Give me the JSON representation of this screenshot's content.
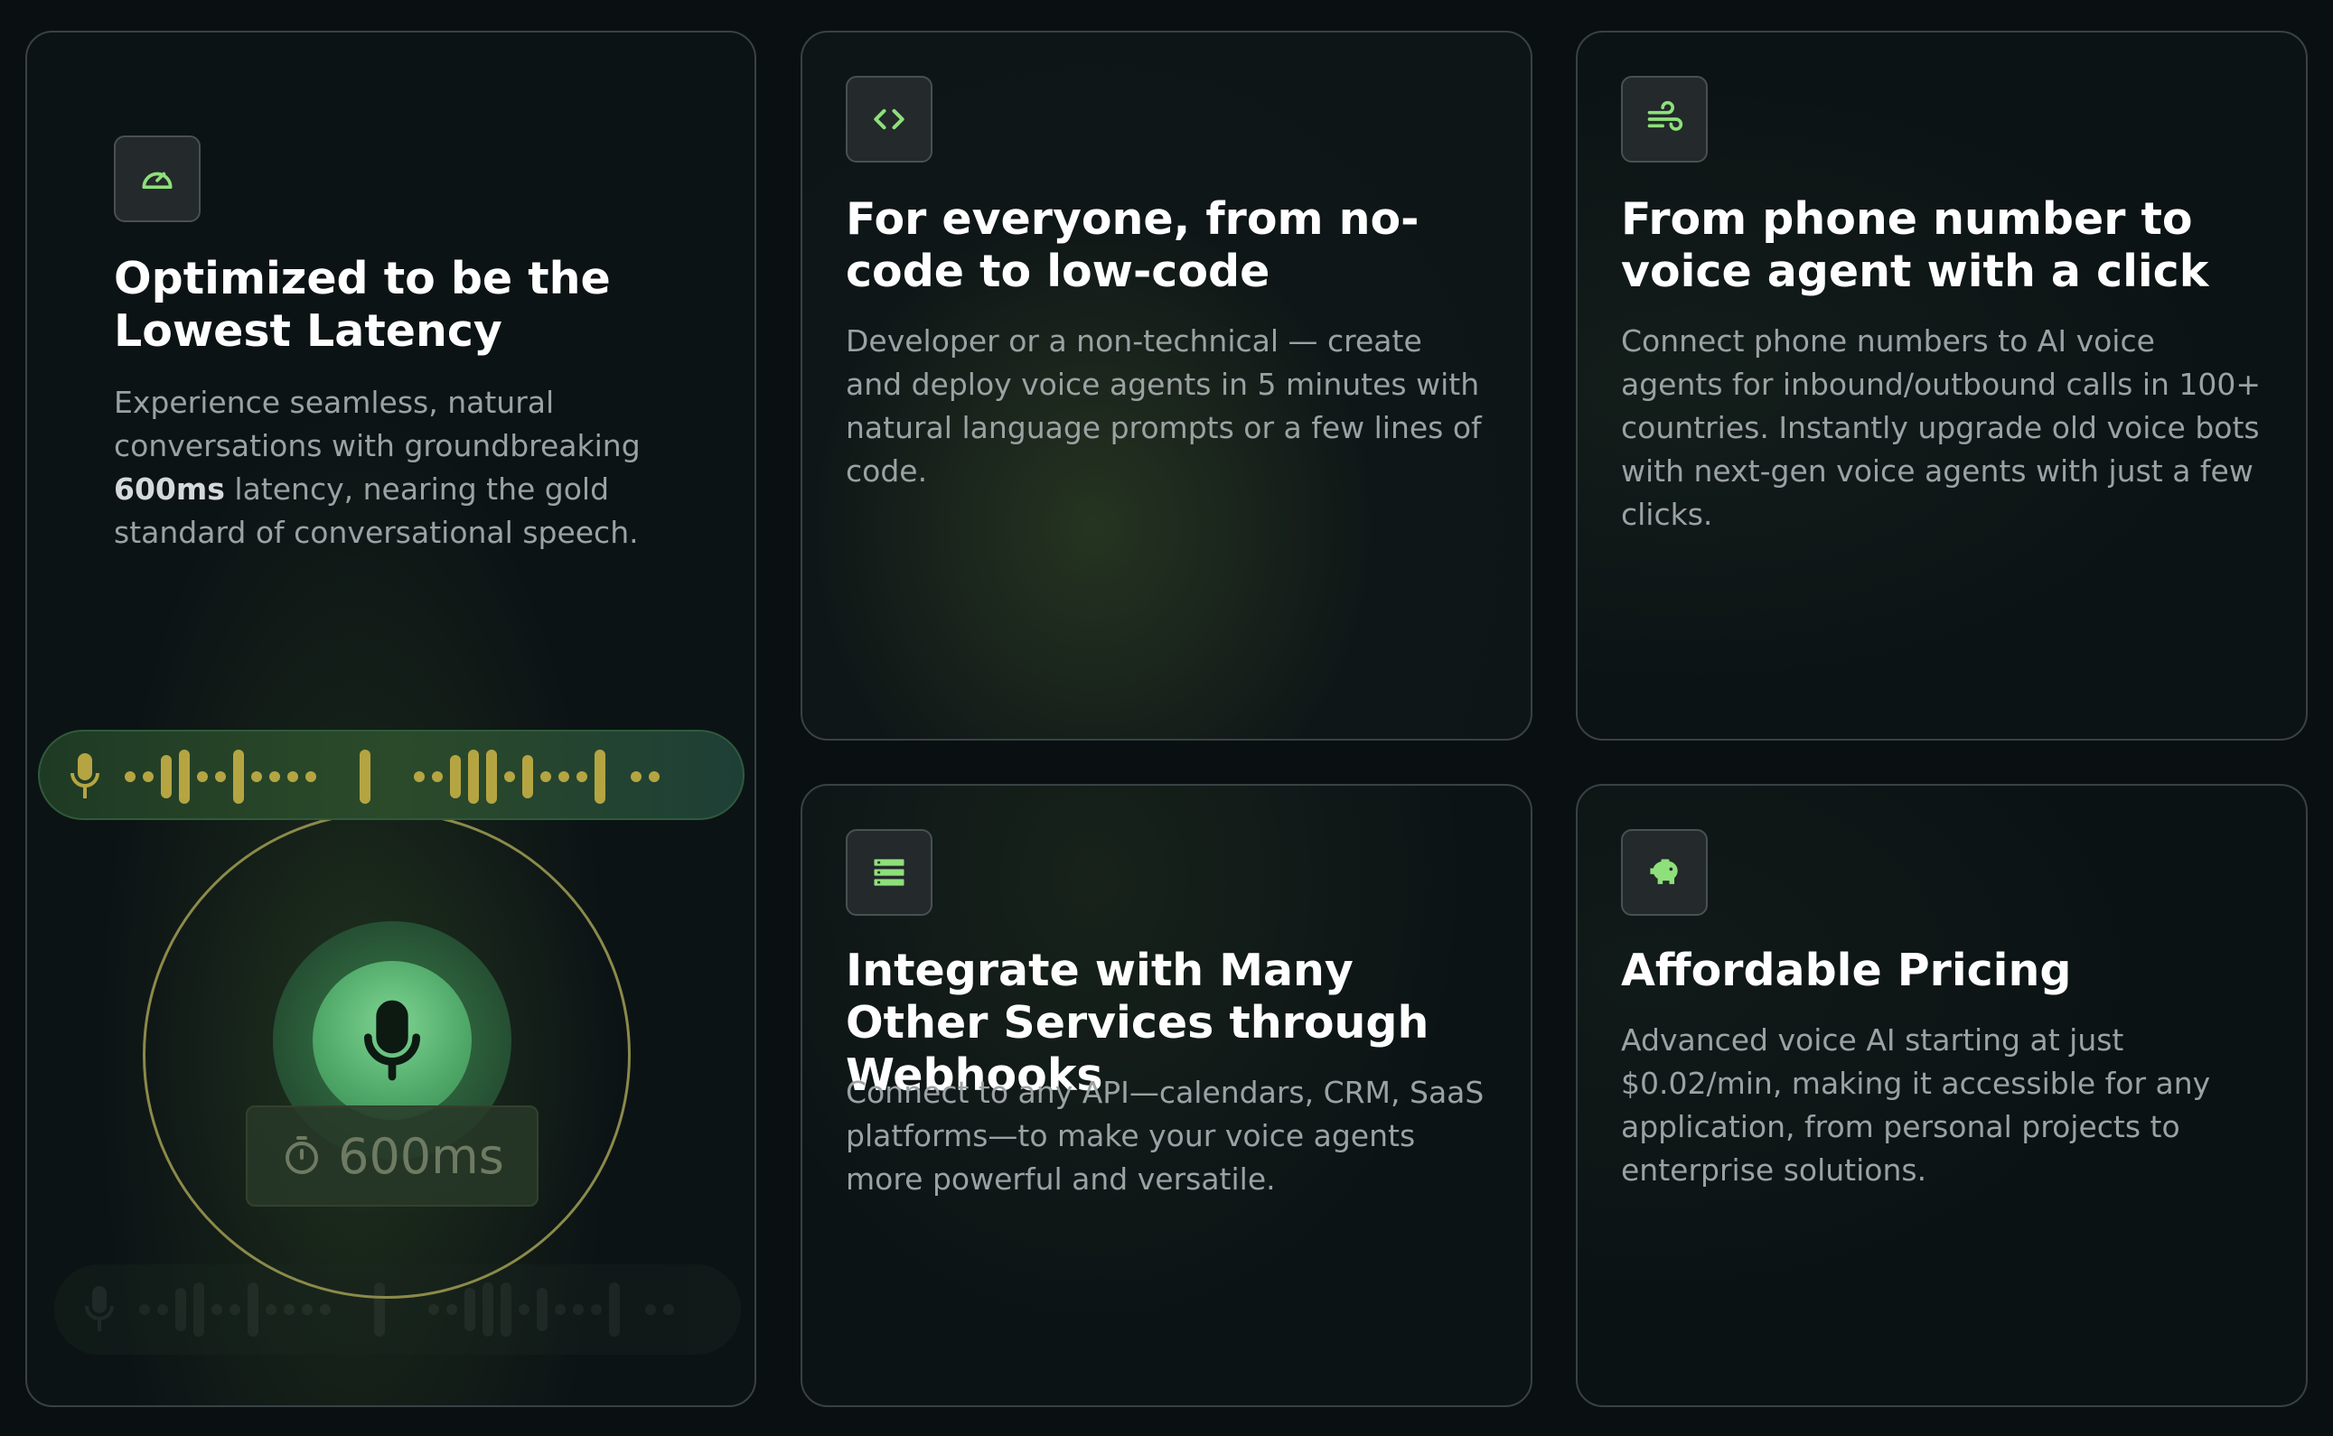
{
  "colors": {
    "accent": "#8ee07a",
    "background": "#0a1012",
    "card_border": "#3a4144",
    "description": "#9ca1a3",
    "wave_gold": "#b5a542"
  },
  "cards": {
    "latency": {
      "icon": "speedometer-icon",
      "title": "Optimized to be the Lowest Latency",
      "desc_before": "Experience seamless, natural conversations with groundbreaking ",
      "desc_bold": "600ms",
      "desc_after": " latency, nearing the gold standard of conversational speech.",
      "badge_value": "600ms",
      "badge_icon": "stopwatch-icon",
      "mic_icon": "microphone-icon"
    },
    "nocode": {
      "icon": "code-brackets-icon",
      "title": "For everyone, from no-code to low-code",
      "desc": "Developer or a non-technical — create and deploy voice agents in 5 minutes with natural language prompts or a few lines of code."
    },
    "phone": {
      "icon": "wind-icon",
      "title": "From phone number to voice agent with a click",
      "desc": "Connect phone numbers to AI voice agents for inbound/outbound calls in 100+ countries. Instantly upgrade old voice bots with next-gen voice agents with just a few clicks."
    },
    "webhooks": {
      "icon": "server-stack-icon",
      "title": "Integrate with Many Other Services through Webhooks",
      "desc": "Connect to any API—calendars, CRM, SaaS platforms—to make your voice agents more powerful and versatile."
    },
    "pricing": {
      "icon": "piggy-bank-icon",
      "title": "Affordable Pricing",
      "desc": "Advanced voice AI starting at just $0.02/min, making it accessible for any application, from personal projects to enterprise solutions."
    }
  }
}
